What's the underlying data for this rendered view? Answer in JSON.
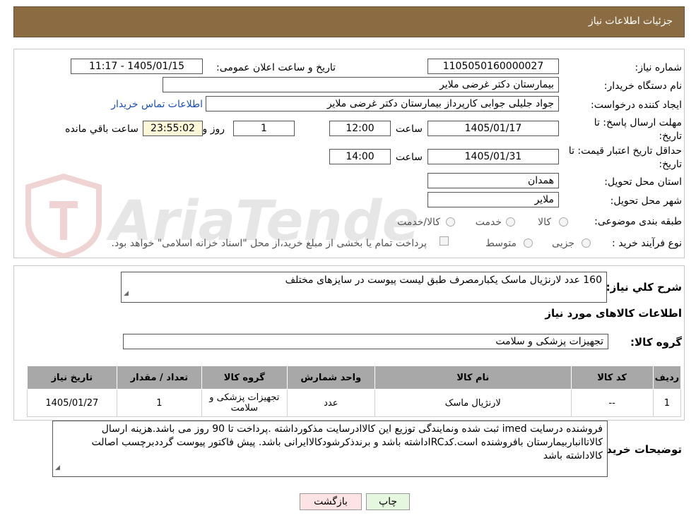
{
  "header": {
    "title": "جزئیات اطلاعات نیاز"
  },
  "form": {
    "need_number": {
      "label": "شماره نیاز:",
      "value": "1105050160000027"
    },
    "announce_datetime": {
      "label": "تاریخ و ساعت اعلان عمومی:",
      "value": "1405/01/15 - 11:17"
    },
    "buyer_org": {
      "label": "نام دستگاه خریدار:",
      "value": "بیمارستان دکتر غرضی ملایر"
    },
    "requester": {
      "label": "ایجاد کننده درخواست:",
      "value": "جواد جلیلی جوابی کارپرداز بیمارستان دکتر غرضی ملایر",
      "contact_link": "اطلاعات تماس خریدار"
    },
    "reply_deadline": {
      "label_line1": "مهلت ارسال پاسخ: تا",
      "label_line2": "تاریخ:",
      "date": "1405/01/17",
      "time_label": "ساعت",
      "time": "12:00",
      "days": "1",
      "days_label": "روز و",
      "remaining": "23:55:02",
      "remaining_label": "ساعت باقي مانده"
    },
    "price_validity": {
      "label_line1": "حداقل تاریخ اعتبار قیمت: تا",
      "label_line2": "تاریخ:",
      "date": "1405/01/31",
      "time_label": "ساعت",
      "time": "14:00"
    },
    "province": {
      "label": "استان محل تحویل:",
      "value": "همدان"
    },
    "city": {
      "label": "شهر محل تحویل:",
      "value": "ملایر"
    },
    "category": {
      "label": "طبقه بندی موضوعی:",
      "options": [
        "کالا",
        "خدمت",
        "کالا/خدمت"
      ]
    },
    "process": {
      "label": "نوع فرآیند خرید :",
      "options": [
        "جزیی",
        "متوسط"
      ],
      "payment_note": "پرداخت تمام یا بخشی از مبلغ خرید،از محل \"اسناد خزانه اسلامی\" خواهد بود."
    }
  },
  "details": {
    "summary_label": "شرح کلي نياز:",
    "summary_value": "160 عدد لارنژیال ماسک یکبارمصرف طبق لیست پیوست در سایزهای مختلف",
    "goods_info_title": "اطلاعات کالاهای مورد نیاز",
    "goods_group_label": "گروه کالا:",
    "goods_group_value": "تجهیزات پزشکی و سلامت"
  },
  "table": {
    "headers": [
      "ردیف",
      "کد کالا",
      "نام کالا",
      "واحد شمارش",
      "گروه کالا",
      "تعداد / مقدار",
      "تاریخ نیاز"
    ],
    "rows": [
      [
        "1",
        "--",
        "لارنژیال ماسک",
        "عدد",
        "تجهیزات پزشکی و سلامت",
        "1",
        "1405/01/27"
      ]
    ]
  },
  "buyer_notes": {
    "label": "توضیحات خریدار:",
    "value": "فروشنده درسایت imed ثبت شده ونمایندگی توزیع این کالاادرسایت مذکورداشته .پرداخت تا  90 روز می باشد.هزینه ارسال کالاتاانباربیمارستان بافروشنده است.کدIRCداشته باشد و برندذکرشودکالاایرانی باشد. پیش فاکتور پیوست گرددبرچسب اصالت کالاداشته باشد"
  },
  "buttons": {
    "print": "چاپ",
    "back": "بازگشت"
  },
  "watermark": {
    "text": "AriaTender.neT"
  },
  "colors": {
    "header_bg": "#8B6C42",
    "table_header_bg": "#a8a8a8",
    "link": "#1a4fb3",
    "print_btn_bg": "#e6f7df",
    "back_btn_bg": "#fde3e3"
  }
}
